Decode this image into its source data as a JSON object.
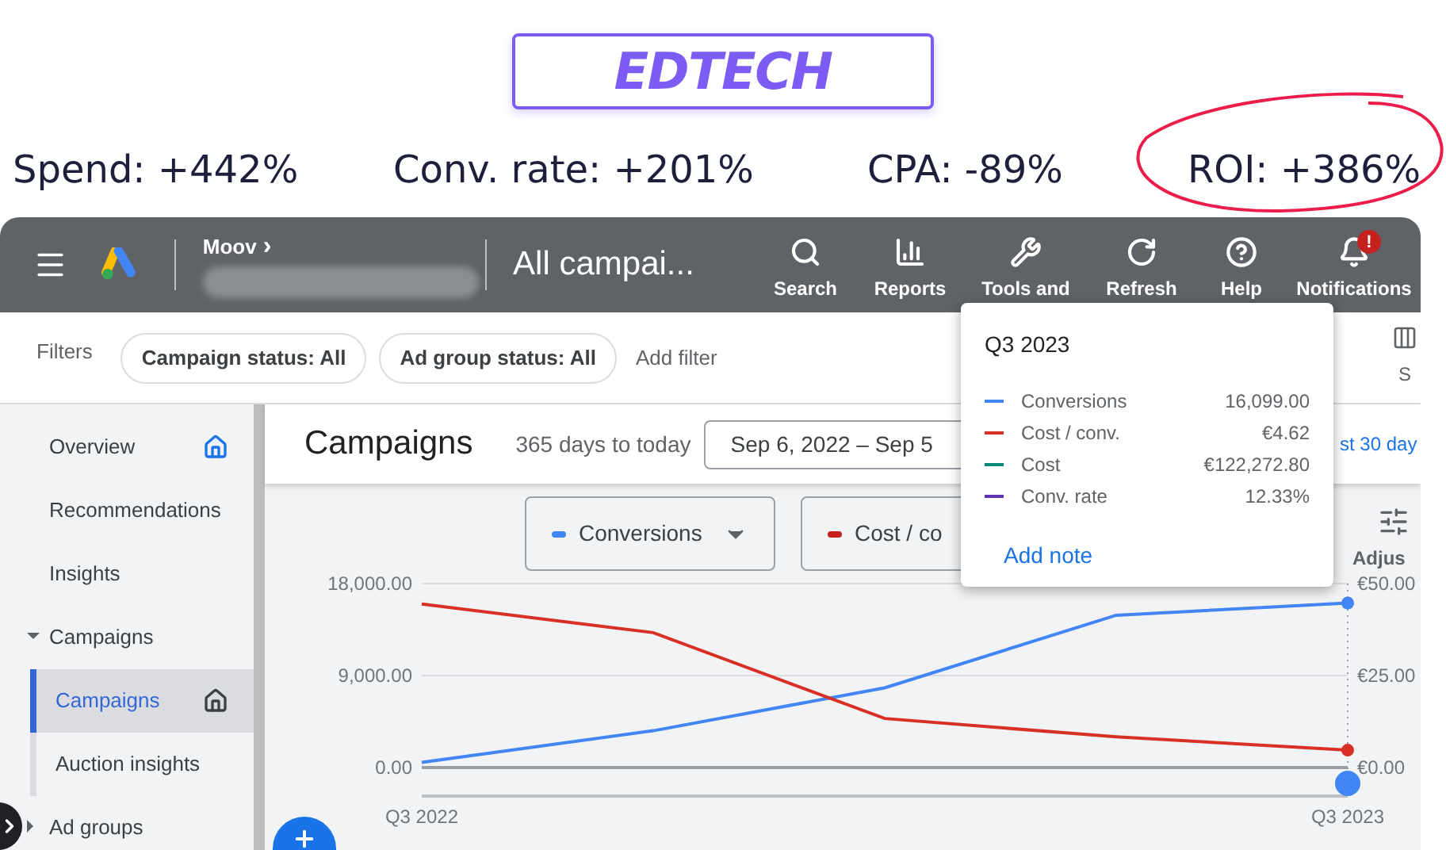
{
  "banner": {
    "title": "EDTECH",
    "stats": [
      {
        "text": "Spend: +442%",
        "circled": false
      },
      {
        "text": "Conv. rate: +201%",
        "circled": false
      },
      {
        "text": "CPA: -89%",
        "circled": false
      },
      {
        "text": "ROI: +386%",
        "circled": true
      }
    ]
  },
  "header": {
    "account": "Moov",
    "account_arrow": "›",
    "page_title": "All campai...",
    "actions": [
      {
        "kind": "search",
        "label": "Search"
      },
      {
        "kind": "reports",
        "label": "Reports"
      },
      {
        "kind": "tools",
        "label": "Tools and"
      },
      {
        "kind": "refresh",
        "label": "Refresh"
      },
      {
        "kind": "help",
        "label": "Help"
      },
      {
        "kind": "notifications",
        "label": "Notifications",
        "badge": "!"
      }
    ]
  },
  "filters": {
    "label": "Filters",
    "chips": [
      "Campaign status: All",
      "Ad group status: All"
    ],
    "add": "Add filter",
    "right_label": "S"
  },
  "sidebar": {
    "items": [
      {
        "label": "Overview",
        "selected": false,
        "color": "#1a73e8"
      },
      {
        "label": "Recommendations",
        "selected": false
      },
      {
        "label": "Insights",
        "selected": false
      },
      {
        "label": "Campaigns",
        "selected": false,
        "expanded": true,
        "children": [
          {
            "label": "Campaigns",
            "selected": true,
            "color": "#3c4043"
          },
          {
            "label": "Auction insights",
            "selected": false
          }
        ]
      },
      {
        "label": "Ad groups",
        "selected": false,
        "expanded": false
      }
    ]
  },
  "main": {
    "title": "Campaigns",
    "range_label": "365 days to today",
    "date_range": "Sep 6, 2022 – Sep 5",
    "quick_link": "st 30 day",
    "legend": [
      {
        "label": "Conversions",
        "color": "#4285f4",
        "dropdown": true
      },
      {
        "label": "Cost / co",
        "color": "#c5221f",
        "dropdown": false
      }
    ],
    "adjust_label": "Adjus",
    "chart": {
      "right_ticks": [
        "€50.00",
        "€25.00",
        "€0.00"
      ],
      "chart_data": {
        "type": "line",
        "categories": [
          "Q3 2022",
          null,
          null,
          null,
          "Q3 2023"
        ],
        "ylim": [
          0,
          18000
        ],
        "yticks": [
          {
            "value": 0,
            "label": "0.00"
          },
          {
            "value": 9000,
            "label": "9,000.00"
          },
          {
            "value": 18000,
            "label": "18,000.00"
          }
        ],
        "series": [
          {
            "color": "#4285f4",
            "values": [
              500,
              3600,
              7800,
              14900,
              16100
            ]
          },
          {
            "color": "#d93025",
            "values": [
              16000,
              13200,
              4800,
              3000,
              1700
            ]
          }
        ]
      }
    }
  },
  "tooltip": {
    "title": "Q3 2023",
    "rows": [
      {
        "label": "Conversions",
        "value": "16,099.00",
        "color": "#4285f4"
      },
      {
        "label": "Cost / conv.",
        "value": "€4.62",
        "color": "#d93025"
      },
      {
        "label": "Cost",
        "value": "€122,272.80",
        "color": "#00897b"
      },
      {
        "label": "Conv. rate",
        "value": "12.33%",
        "color": "#5e35b1"
      }
    ],
    "action": "Add note"
  }
}
